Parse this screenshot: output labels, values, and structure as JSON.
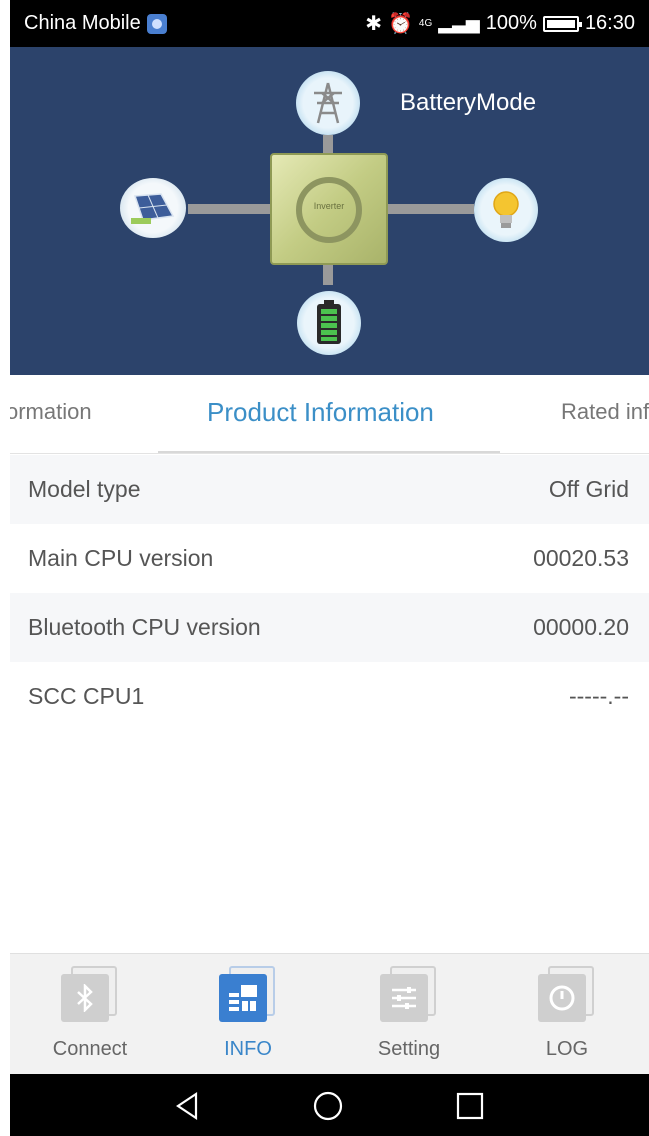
{
  "status_bar": {
    "carrier": "China Mobile",
    "network": "4G",
    "battery_percent": "100%",
    "time": "16:30"
  },
  "diagram": {
    "mode": "BatteryMode",
    "inverter_label": "Inverter",
    "nodes": {
      "grid": "transmission-tower-icon",
      "solar": "solar-panel-icon",
      "load": "light-bulb-icon",
      "battery": "battery-icon"
    },
    "colors": {
      "background": "#2c436b",
      "inverter": "#c3cc84",
      "battery": "#3aa64a"
    }
  },
  "tabs": {
    "left": "ormation",
    "active": "Product Information",
    "right": "Rated inf"
  },
  "info_rows": [
    {
      "label": "Model type",
      "value": "Off Grid"
    },
    {
      "label": "Main CPU version",
      "value": "00020.53"
    },
    {
      "label": "Bluetooth CPU version",
      "value": "00000.20"
    },
    {
      "label": "SCC CPU1",
      "value": "-----.--"
    }
  ],
  "bottom_nav": [
    {
      "label": "Connect",
      "icon": "bluetooth-icon"
    },
    {
      "label": "INFO",
      "icon": "info-icon",
      "active": true
    },
    {
      "label": "Setting",
      "icon": "settings-sliders-icon"
    },
    {
      "label": "LOG",
      "icon": "log-power-icon"
    }
  ],
  "system_nav": [
    "back-icon",
    "home-icon",
    "recents-icon"
  ],
  "accent_color": "#3b8fc7"
}
